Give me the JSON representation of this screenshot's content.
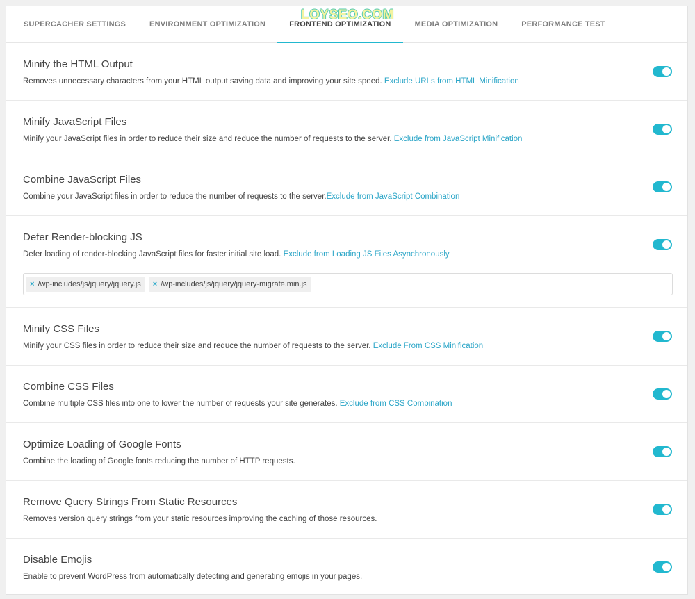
{
  "watermark": "LOYSEO.COM",
  "tabs": [
    {
      "label": "SUPERCACHER SETTINGS",
      "active": false
    },
    {
      "label": "ENVIRONMENT OPTIMIZATION",
      "active": false
    },
    {
      "label": "FRONTEND OPTIMIZATION",
      "active": true
    },
    {
      "label": "MEDIA OPTIMIZATION",
      "active": false
    },
    {
      "label": "PERFORMANCE TEST",
      "active": false
    }
  ],
  "settings": [
    {
      "title": "Minify the HTML Output",
      "desc": "Removes unnecessary characters from your HTML output saving data and improving your site speed. ",
      "link": "Exclude URLs from HTML Minification",
      "enabled": true
    },
    {
      "title": "Minify JavaScript Files",
      "desc": "Minify your JavaScript files in order to reduce their size and reduce the number of requests to the server. ",
      "link": "Exclude from JavaScript Minification",
      "enabled": true
    },
    {
      "title": "Combine JavaScript Files",
      "desc": "Combine your JavaScript files in order to reduce the number of requests to the server.",
      "link": "Exclude from JavaScript Combination",
      "enabled": true
    },
    {
      "title": "Defer Render-blocking JS",
      "desc": "Defer loading of render-blocking JavaScript files for faster initial site load. ",
      "link": "Exclude from Loading JS Files Asynchronously",
      "enabled": true
    },
    {
      "title": "Minify CSS Files",
      "desc": "Minify your CSS files in order to reduce their size and reduce the number of requests to the server. ",
      "link": "Exclude From CSS Minification",
      "enabled": true
    },
    {
      "title": "Combine CSS Files",
      "desc": "Combine multiple CSS files into one to lower the number of requests your site generates. ",
      "link": "Exclude from CSS Combination",
      "enabled": true
    },
    {
      "title": "Optimize Loading of Google Fonts",
      "desc": "Combine the loading of Google fonts reducing the number of HTTP requests.",
      "link": "",
      "enabled": true
    },
    {
      "title": "Remove Query Strings From Static Resources",
      "desc": "Removes version query strings from your static resources improving the caching of those resources.",
      "link": "",
      "enabled": true
    },
    {
      "title": "Disable Emojis",
      "desc": "Enable to prevent WordPress from automatically detecting and generating emojis in your pages.",
      "link": "",
      "enabled": true
    }
  ],
  "defer_tags": {
    "remove_glyph": "×",
    "items": [
      "/wp-includes/js/jquery/jquery.js",
      "/wp-includes/js/jquery/jquery-migrate.min.js"
    ]
  },
  "colors": {
    "accent": "#22b8cf",
    "link": "#2aa5c7"
  }
}
